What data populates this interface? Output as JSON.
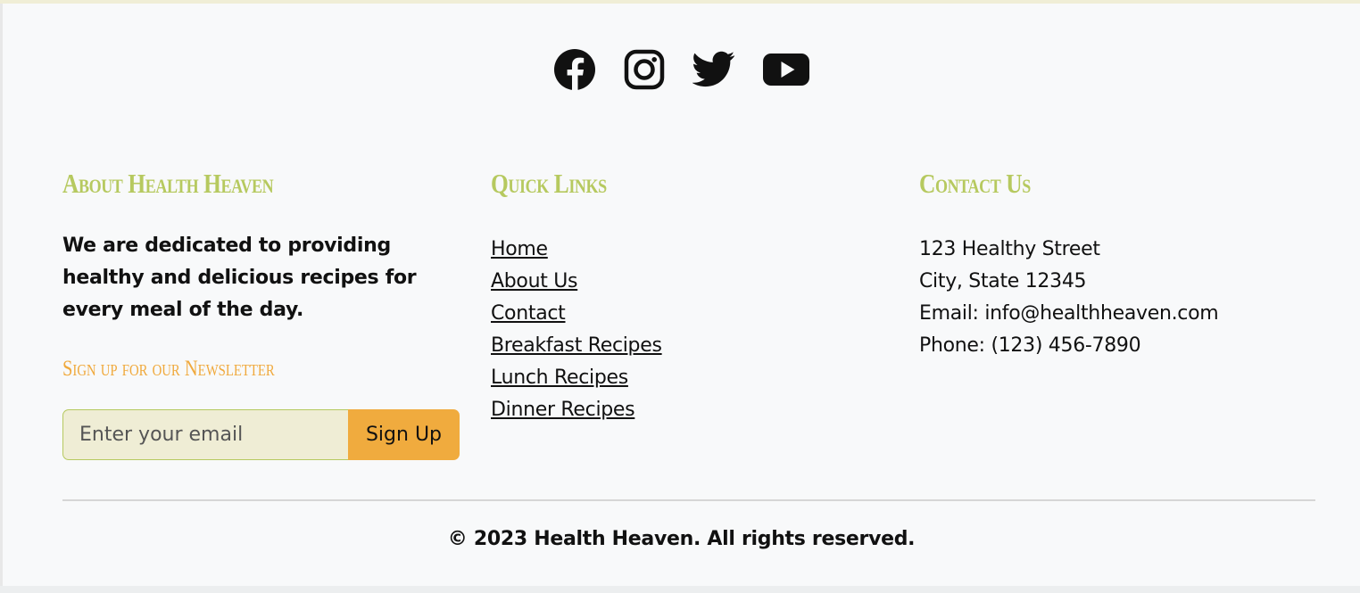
{
  "colors": {
    "heading": "#b6c95f",
    "newsletter_heading": "#f0a93c",
    "button": "#f0ab3e",
    "input_bg": "#efedd5",
    "footer_bg": "#f8f9fa"
  },
  "social": [
    {
      "name": "facebook-icon"
    },
    {
      "name": "instagram-icon"
    },
    {
      "name": "twitter-icon"
    },
    {
      "name": "youtube-icon"
    }
  ],
  "about": {
    "heading": "About Health Heaven",
    "text": "We are dedicated to providing healthy and delicious recipes for every meal of the day.",
    "newsletter_heading": "Sign up for our Newsletter",
    "email_placeholder": "Enter your email",
    "signup_label": "Sign Up"
  },
  "links": {
    "heading": "Quick Links",
    "items": [
      {
        "label": "Home"
      },
      {
        "label": "About Us"
      },
      {
        "label": "Contact"
      },
      {
        "label": "Breakfast Recipes"
      },
      {
        "label": "Lunch Recipes"
      },
      {
        "label": "Dinner Recipes"
      }
    ]
  },
  "contact": {
    "heading": "Contact Us",
    "address1": "123 Healthy Street",
    "address2": "City, State 12345",
    "email": "Email: info@healthheaven.com",
    "phone": "Phone: (123) 456-7890"
  },
  "copyright": "© 2023 Health Heaven. All rights reserved."
}
